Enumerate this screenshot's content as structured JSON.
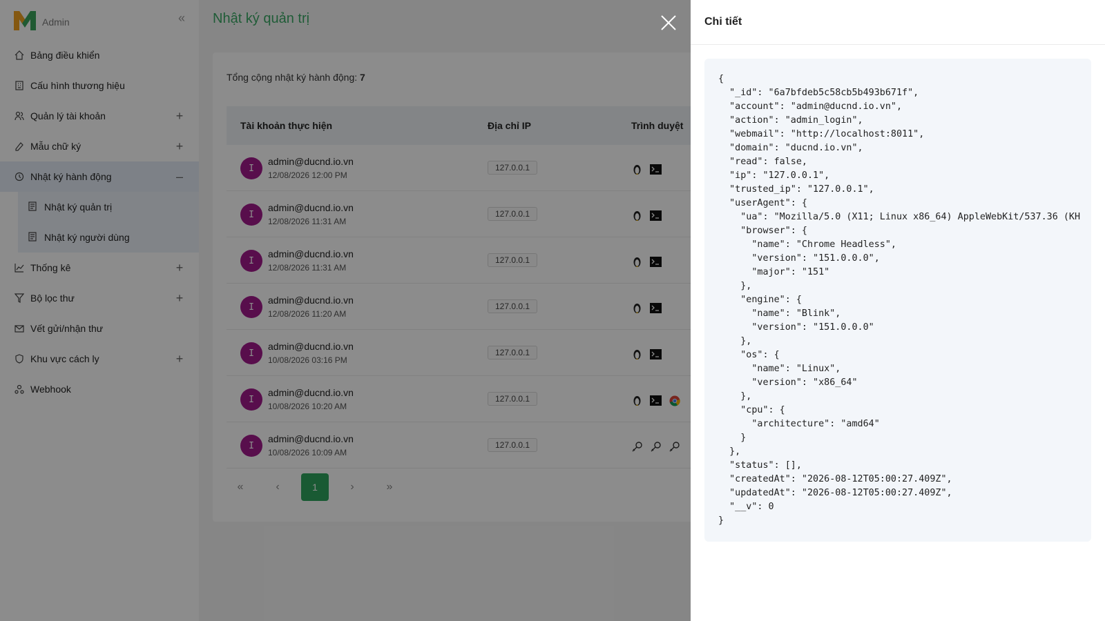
{
  "sidebar": {
    "brand": "Admin",
    "collapse_icon": "double-chevron-left-icon",
    "items": [
      {
        "label": "Bảng điều khiển",
        "icon": "home-icon",
        "toggle": ""
      },
      {
        "label": "Cấu hình thương hiệu",
        "icon": "building-icon",
        "toggle": ""
      },
      {
        "label": "Quản lý tài khoản",
        "icon": "users-icon",
        "toggle": "+"
      },
      {
        "label": "Mẫu chữ ký",
        "icon": "signature-icon",
        "toggle": "+"
      },
      {
        "label": "Nhật ký hành động",
        "icon": "log-icon",
        "toggle": "–"
      }
    ],
    "subitems": [
      {
        "label": "Nhật ký quản trị"
      },
      {
        "label": "Nhật ký người dùng"
      }
    ],
    "items_after": [
      {
        "label": "Thống kê",
        "toggle": "+"
      },
      {
        "label": "Bộ lọc thư",
        "toggle": "+"
      },
      {
        "label": "Vết gửi/nhận thư",
        "toggle": ""
      },
      {
        "label": "Khu vực cách ly",
        "toggle": "+"
      },
      {
        "label": "Webhook",
        "toggle": ""
      }
    ]
  },
  "main": {
    "title": "Nhật ký quản trị",
    "total_label": "Tổng cộng nhật ký hành động: ",
    "total_value": "7",
    "columns": [
      "Tài khoản thực hiện",
      "Địa chỉ IP",
      "Trình duyệt"
    ],
    "rows": [
      {
        "avatar": "I",
        "account": "admin@ducnd.io.vn",
        "time": "12/08/2026 12:00 PM",
        "ip": "127.0.0.1"
      },
      {
        "avatar": "I",
        "account": "admin@ducnd.io.vn",
        "time": "12/08/2026 11:31 AM",
        "ip": "127.0.0.1"
      },
      {
        "avatar": "I",
        "account": "admin@ducnd.io.vn",
        "time": "12/08/2026 11:31 AM",
        "ip": "127.0.0.1"
      },
      {
        "avatar": "I",
        "account": "admin@ducnd.io.vn",
        "time": "12/08/2026 11:20 AM",
        "ip": "127.0.0.1"
      },
      {
        "avatar": "I",
        "account": "admin@ducnd.io.vn",
        "time": "10/08/2026 03:16 PM",
        "ip": "127.0.0.1"
      },
      {
        "avatar": "I",
        "account": "admin@ducnd.io.vn",
        "time": "10/08/2026 10:20 AM",
        "ip": "127.0.0.1"
      },
      {
        "avatar": "I",
        "account": "admin@ducnd.io.vn",
        "time": "10/08/2026 10:09 AM",
        "ip": "127.0.0.1"
      }
    ],
    "pager": {
      "first": "«",
      "prev": "‹",
      "current": "1",
      "next": "›",
      "last": "»"
    }
  },
  "drawer": {
    "title": "Chi tiết",
    "json_text": "{\n  \"_id\": \"6a7bfdeb5c58cb5b493b671f\",\n  \"account\": \"admin@ducnd.io.vn\",\n  \"action\": \"admin_login\",\n  \"webmail\": \"http://localhost:8011\",\n  \"domain\": \"ducnd.io.vn\",\n  \"read\": false,\n  \"ip\": \"127.0.0.1\",\n  \"trusted_ip\": \"127.0.0.1\",\n  \"userAgent\": {\n    \"ua\": \"Mozilla/5.0 (X11; Linux x86_64) AppleWebKit/537.36 (KH\n    \"browser\": {\n      \"name\": \"Chrome Headless\",\n      \"version\": \"151.0.0.0\",\n      \"major\": \"151\"\n    },\n    \"engine\": {\n      \"name\": \"Blink\",\n      \"version\": \"151.0.0.0\"\n    },\n    \"os\": {\n      \"name\": \"Linux\",\n      \"version\": \"x86_64\"\n    },\n    \"cpu\": {\n      \"architecture\": \"amd64\"\n    }\n  },\n  \"status\": [],\n  \"createdAt\": \"2026-08-12T05:00:27.409Z\",\n  \"updatedAt\": \"2026-08-12T05:00:27.409Z\",\n  \"__v\": 0\n}"
  },
  "colors": {
    "accent": "#2fa55d",
    "title": "#3aa864",
    "avatar": "#a11a8a"
  }
}
